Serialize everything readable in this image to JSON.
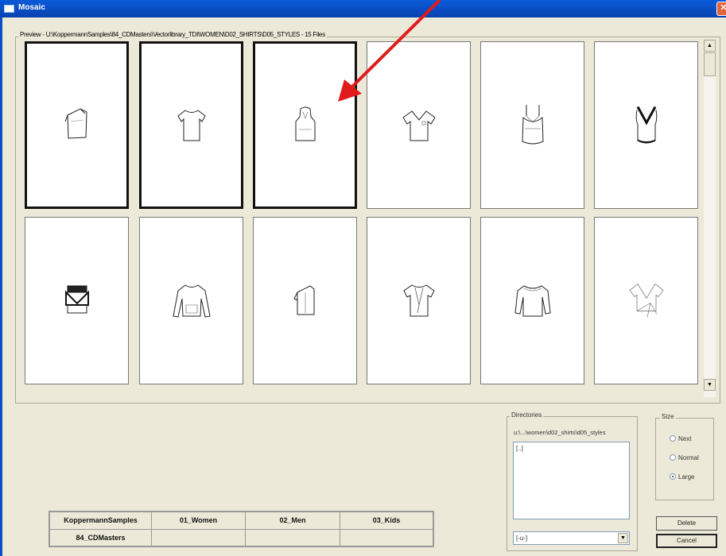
{
  "window": {
    "title": "Mosaic",
    "close_glyph": "✕"
  },
  "preview": {
    "legend": "Preview - U:\\KoppermannSamples\\84_CDMasters\\Vectorlibrary_TDI\\WOMEN\\D02_SHIRTS\\D05_STYLES - 15 Files",
    "thumbnails": [
      {
        "icon": "one-shoulder-top-icon",
        "selected": true
      },
      {
        "icon": "tshirt-icon",
        "selected": true
      },
      {
        "icon": "hooded-top-icon",
        "selected": true
      },
      {
        "icon": "v-neck-tshirt-icon",
        "selected": false
      },
      {
        "icon": "camisole-icon",
        "selected": false
      },
      {
        "icon": "lace-tank-icon",
        "selected": false
      },
      {
        "icon": "bikini-top-icon",
        "selected": false
      },
      {
        "icon": "sweatshirt-icon",
        "selected": false
      },
      {
        "icon": "asymmetric-top-icon",
        "selected": false
      },
      {
        "icon": "drape-top-icon",
        "selected": false
      },
      {
        "icon": "long-sleeve-top-icon",
        "selected": false
      },
      {
        "icon": "wrap-top-icon",
        "selected": false
      }
    ]
  },
  "scrollbar": {
    "up_glyph": "▲",
    "down_glyph": "▼"
  },
  "directories": {
    "legend": "Directories",
    "path": "u:\\...\\women\\d02_shirts\\d05_styles",
    "list_items": [
      "[..]"
    ],
    "drive_value": "[-u-]",
    "drop_glyph": "▼"
  },
  "size": {
    "legend": "Size",
    "options": [
      {
        "label": "Next",
        "checked": false
      },
      {
        "label": "Normal",
        "checked": false
      },
      {
        "label": "Large",
        "checked": true
      }
    ]
  },
  "buttons": {
    "delete": "Delete",
    "cancel": "Cancel"
  },
  "path_table": {
    "row1": [
      "KoppermannSamples",
      "01_Women",
      "02_Men",
      "03_Kids"
    ],
    "row2": [
      "84_CDMasters",
      "",
      "",
      ""
    ]
  },
  "colors": {
    "titlebar": "#0a4fc6",
    "annotation_arrow": "#e01b1b",
    "window_bg": "#ece9d8"
  }
}
